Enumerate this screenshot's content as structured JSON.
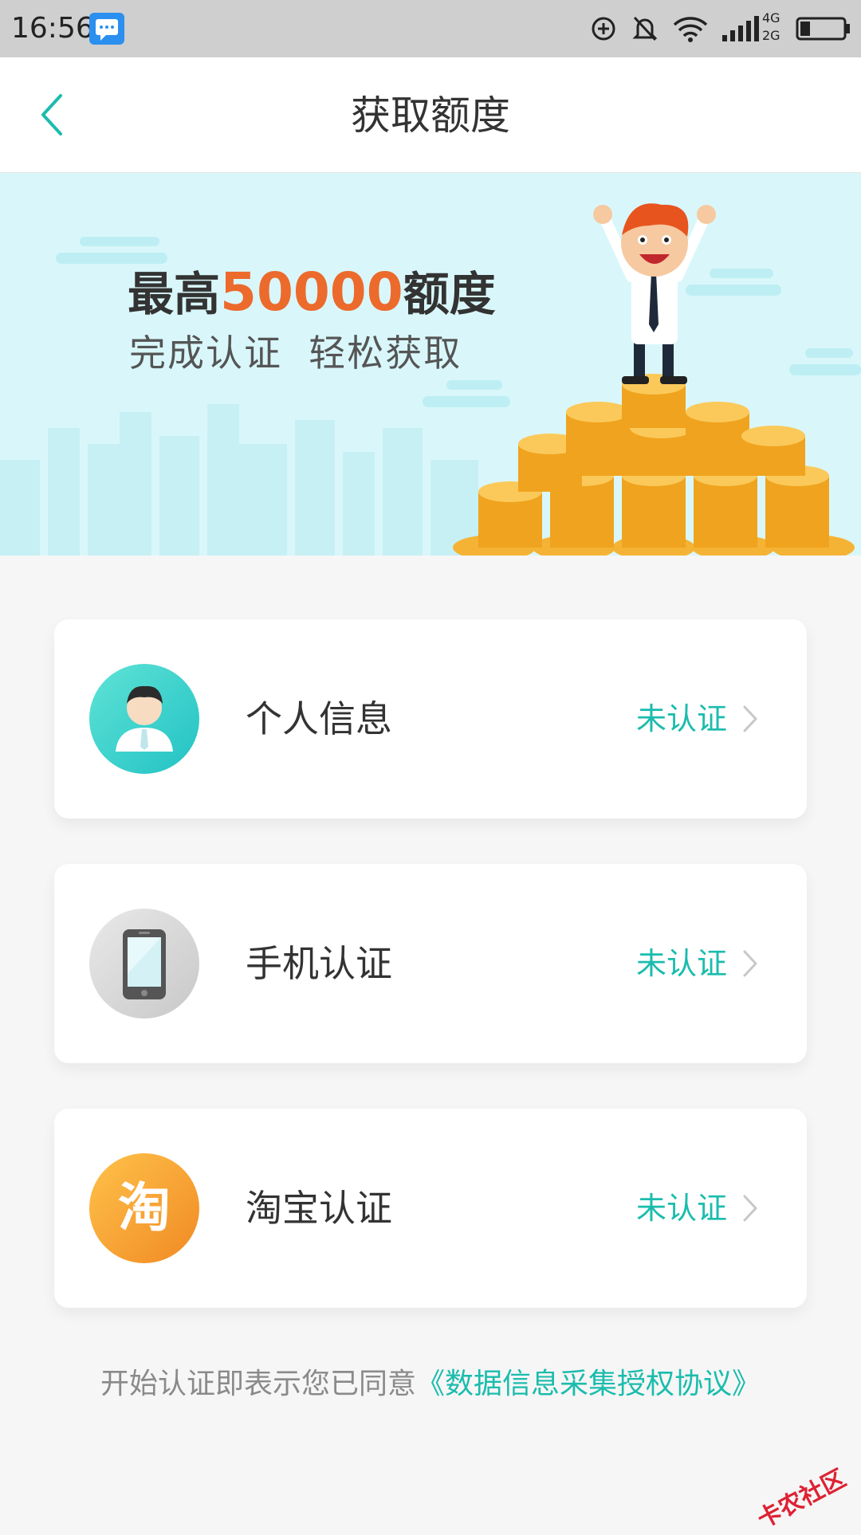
{
  "status_bar": {
    "time": "16:56",
    "network_labels": [
      "4G",
      "2G"
    ]
  },
  "nav": {
    "title": "获取额度"
  },
  "banner": {
    "title_prefix": "最高",
    "title_amount": "50000",
    "title_suffix": "额度",
    "subtitle": "完成认证  轻松获取"
  },
  "cards": [
    {
      "label": "个人信息",
      "status": "未认证",
      "icon": "user-avatar-icon"
    },
    {
      "label": "手机认证",
      "status": "未认证",
      "icon": "phone-icon"
    },
    {
      "label": "淘宝认证",
      "status": "未认证",
      "icon": "taobao-icon",
      "icon_char": "淘"
    }
  ],
  "agreement": {
    "prefix": "开始认证即表示您已同意",
    "link": "《数据信息采集授权协议》"
  },
  "watermark": "卡农社区",
  "colors": {
    "accent": "#1bbcad",
    "amount": "#ec6a2c",
    "banner_bg": "#d9f7fa"
  }
}
